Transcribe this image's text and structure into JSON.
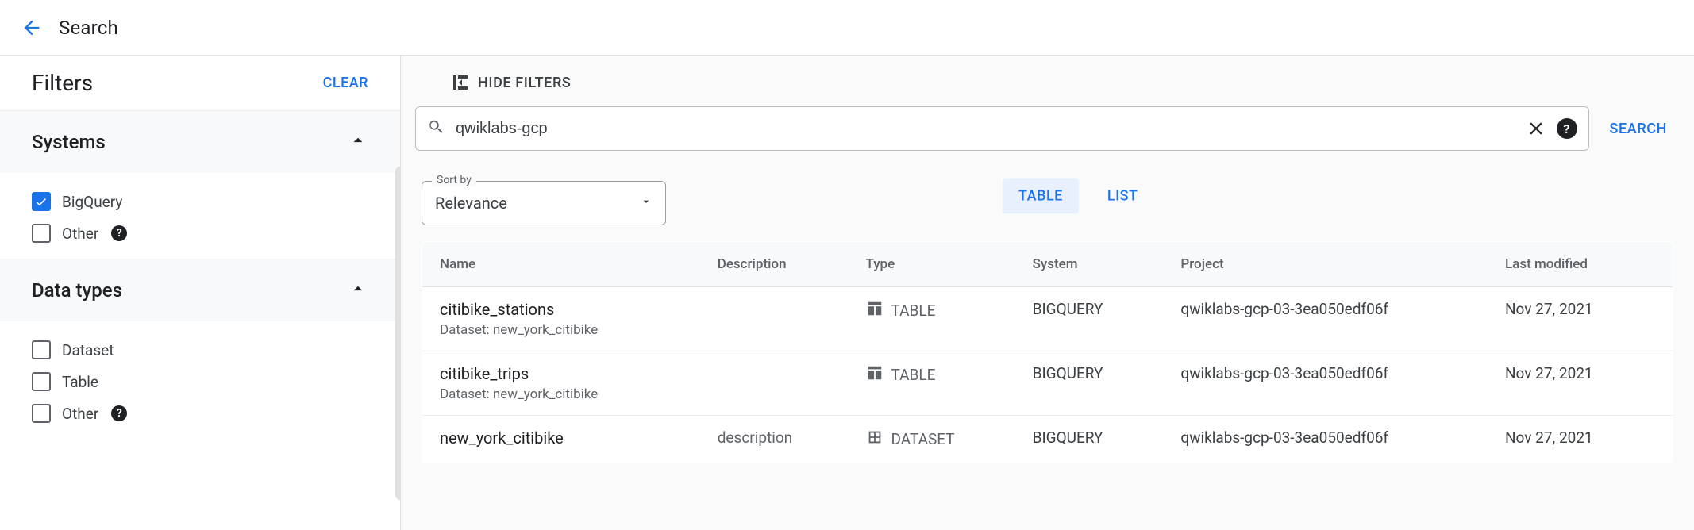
{
  "header": {
    "page_title": "Search"
  },
  "sidebar": {
    "title": "Filters",
    "clear_label": "CLEAR",
    "groups": {
      "systems": {
        "title": "Systems",
        "items": [
          {
            "label": "BigQuery",
            "checked": true,
            "help": false
          },
          {
            "label": "Other",
            "checked": false,
            "help": true
          }
        ]
      },
      "data_types": {
        "title": "Data types",
        "items": [
          {
            "label": "Dataset",
            "checked": false,
            "help": false
          },
          {
            "label": "Table",
            "checked": false,
            "help": false
          },
          {
            "label": "Other",
            "checked": false,
            "help": true
          }
        ]
      }
    }
  },
  "main": {
    "hide_filters_label": "HIDE FILTERS",
    "search": {
      "value": "qwiklabs-gcp",
      "placeholder": "Search",
      "button_label": "SEARCH"
    },
    "sort": {
      "legend": "Sort by",
      "value": "Relevance"
    },
    "view": {
      "table_label": "TABLE",
      "list_label": "LIST",
      "active": "TABLE"
    },
    "columns": {
      "name": "Name",
      "description": "Description",
      "type": "Type",
      "system": "System",
      "project": "Project",
      "last_modified": "Last modified"
    },
    "rows": [
      {
        "name": "citibike_stations",
        "sub": "Dataset: new_york_citibike",
        "description": "",
        "type": "TABLE",
        "type_icon": "table",
        "system": "BIGQUERY",
        "project": "qwiklabs-gcp-03-3ea050edf06f",
        "last_modified": "Nov 27, 2021"
      },
      {
        "name": "citibike_trips",
        "sub": "Dataset: new_york_citibike",
        "description": "",
        "type": "TABLE",
        "type_icon": "table",
        "system": "BIGQUERY",
        "project": "qwiklabs-gcp-03-3ea050edf06f",
        "last_modified": "Nov 27, 2021"
      },
      {
        "name": "new_york_citibike",
        "sub": "",
        "description": "description",
        "type": "DATASET",
        "type_icon": "dataset",
        "system": "BIGQUERY",
        "project": "qwiklabs-gcp-03-3ea050edf06f",
        "last_modified": "Nov 27, 2021"
      }
    ]
  }
}
